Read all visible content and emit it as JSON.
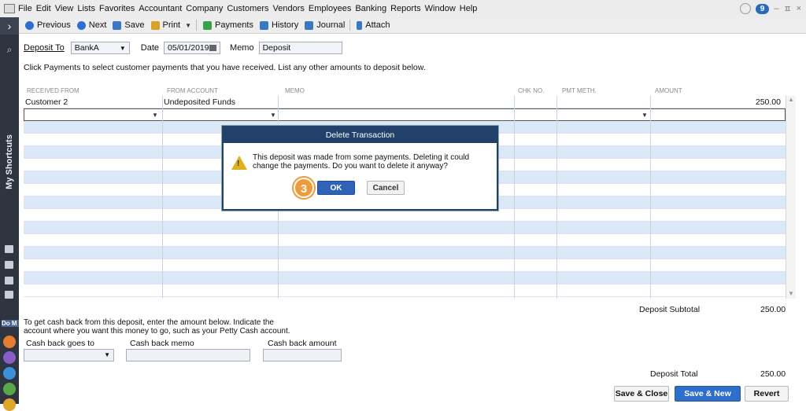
{
  "menu": [
    "File",
    "Edit",
    "View",
    "Lists",
    "Favorites",
    "Accountant",
    "Company",
    "Customers",
    "Vendors",
    "Employees",
    "Banking",
    "Reports",
    "Window",
    "Help"
  ],
  "notifications": {
    "count": "9"
  },
  "window_controls": {
    "minimize": "–",
    "restore": "ㅍ",
    "close": "×"
  },
  "rail": {
    "expand": "›",
    "shortcuts": "My Shortcuts",
    "do_more": "Do M"
  },
  "toolbar": {
    "previous": "Previous",
    "next": "Next",
    "save": "Save",
    "print": "Print",
    "payments": "Payments",
    "history": "History",
    "journal": "Journal",
    "attach": "Attach"
  },
  "header": {
    "deposit_to_label": "Deposit To",
    "deposit_to_value": "BankA",
    "date_label": "Date",
    "date_value": "05/01/2019",
    "memo_label": "Memo",
    "memo_value": "Deposit"
  },
  "instructions": "Click Payments to select customer payments that you have received. List any other amounts to deposit below.",
  "table": {
    "columns": [
      "RECEIVED FROM",
      "FROM ACCOUNT",
      "MEMO",
      "CHK NO.",
      "PMT METH.",
      "AMOUNT"
    ],
    "rows": [
      {
        "received_from": "Customer 2",
        "from_account": "Undeposited Funds",
        "memo": "",
        "chk_no": "",
        "pmt_meth": "",
        "amount": "250.00"
      }
    ]
  },
  "totals": {
    "subtotal_label": "Deposit Subtotal",
    "subtotal_value": "250.00",
    "total_label": "Deposit Total",
    "total_value": "250.00"
  },
  "cashback": {
    "text": "To get cash back from this deposit, enter the amount below.  Indicate the account where you want this money to go, such as your Petty Cash account.",
    "goes_to_label": "Cash back goes to",
    "memo_label": "Cash back memo",
    "amount_label": "Cash back amount"
  },
  "buttons": {
    "save_close": "Save & Close",
    "save_new": "Save & New",
    "revert": "Revert"
  },
  "dialog": {
    "title": "Delete Transaction",
    "message": "This deposit was made from some payments.  Deleting it could change the payments.  Do you want to delete it anyway?",
    "ok": "OK",
    "cancel": "Cancel",
    "step": "3"
  },
  "colors": {
    "accent": "#2f6fcb",
    "dialog_title": "#22406a",
    "step": "#f19a3b",
    "rail": "#2f3540"
  }
}
